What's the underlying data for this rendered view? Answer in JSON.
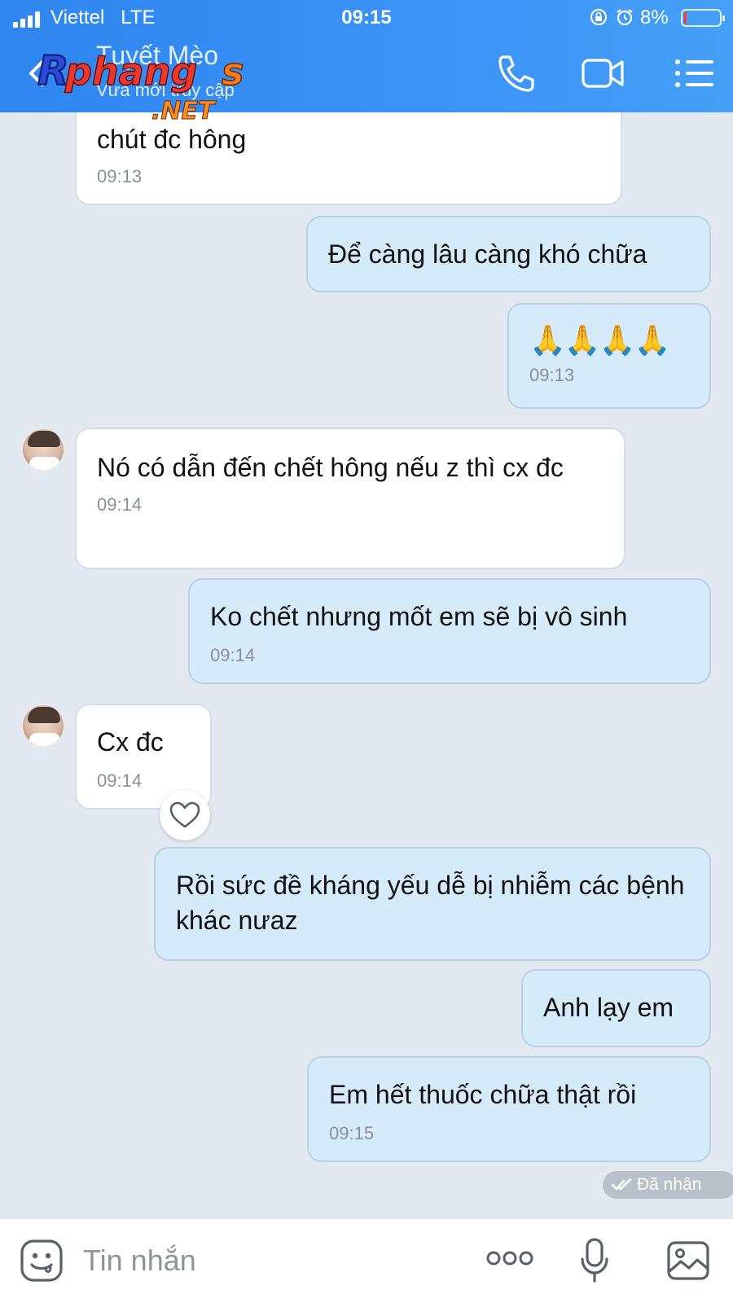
{
  "status_bar": {
    "carrier": "Viettel",
    "network": "LTE",
    "time": "09:15",
    "battery": "8%",
    "battery_level": 0.08
  },
  "header": {
    "contact_name": "Tuyết Mèo",
    "contact_status": "Vừa mới truy cập",
    "watermark": "Rphangs .NET",
    "icons": [
      "back-icon",
      "phone-icon",
      "video-icon",
      "menu-icon"
    ]
  },
  "messages": [
    {
      "dir": "in",
      "text": "chút đc hông",
      "time": "09:13"
    },
    {
      "dir": "out",
      "text": "Để càng lâu càng khó chữa",
      "time": ""
    },
    {
      "dir": "out",
      "text": "🙏🙏🙏🙏",
      "time": "09:13"
    },
    {
      "dir": "in",
      "text": "Nó có dẫn đến chết hông nếu z thì cx đc",
      "time": "09:14"
    },
    {
      "dir": "out",
      "text": "Ko chết nhưng mốt em sẽ bị vô sinh",
      "time": "09:14"
    },
    {
      "dir": "in",
      "text": "Cx đc",
      "time": "09:14"
    },
    {
      "dir": "out",
      "text": "Rồi sức đề kháng yếu dễ bị nhiễm các bệnh khác nưaz",
      "time": ""
    },
    {
      "dir": "out",
      "text": "Anh lạy em",
      "time": ""
    },
    {
      "dir": "out",
      "text": "Em hết thuốc chữa thật rồi",
      "time": "09:15"
    }
  ],
  "delivery_status": "Đã nhận",
  "input": {
    "placeholder": "Tin nhắn"
  },
  "colors": {
    "header": "#3b93f5",
    "outgoing_bubble": "#d5ebfa",
    "incoming_bubble": "#ffffff",
    "background": "#e2e9f1"
  }
}
